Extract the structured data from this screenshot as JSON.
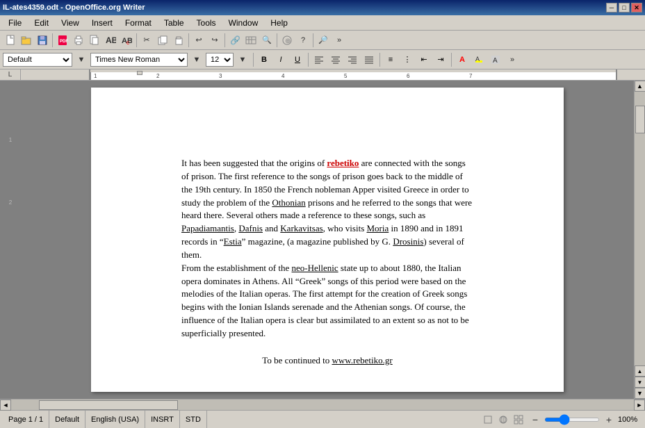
{
  "titleBar": {
    "title": "IL-ates4359.odt - OpenOffice.org Writer",
    "minimize": "─",
    "maximize": "□",
    "close": "✕"
  },
  "menuBar": {
    "items": [
      "File",
      "Edit",
      "View",
      "Insert",
      "Format",
      "Table",
      "Tools",
      "Window",
      "Help"
    ]
  },
  "toolbar1": {
    "new_icon": "📄",
    "open_icon": "📂",
    "save_icon": "💾"
  },
  "formatBar": {
    "style_value": "Default",
    "font_value": "Times New Roman",
    "size_value": "12",
    "bold": "B",
    "italic": "I",
    "underline": "U"
  },
  "documentContent": {
    "paragraph1": "It has been suggested that the origins of ",
    "rebetiko": "rebetiko",
    "paragraph1b": " are connected with the songs of prison. The first reference to the songs of prison goes back to the middle of the 19th century. In 1850 the French nobleman Apper visited Greece in order to study the problem of the ",
    "othonian": "Othonian",
    "paragraph1c": " prisons and he referred to the songs that were heard there. Several others made a reference to these songs, such as ",
    "papadiamantis": "Papadiamantis",
    "paragraph1d": ", ",
    "dafnis": "Dafnis",
    "paragraph1e": " and ",
    "karkavitsas": "Karkavitsas",
    "paragraph1f": ", who visits ",
    "moria": "Moria",
    "paragraph1g": " in 1890 and in 1891 records in “",
    "estia": "Estia",
    "paragraph1h": "” magazine, (a magazine published by G. ",
    "drosinis": "Drosinis",
    "paragraph1i": ") several of them.",
    "paragraph2": "From the establishment of the ",
    "neo_hellenic": "neo-Hellenic",
    "paragraph2b": " state up to about 1880, the Italian opera dominates in Athens. All “Greek” songs of this period were based on the melodies of the Italian operas. The first attempt for the creation of Greek songs begins with the Ionian Islands serenade and the Athenian songs. Of course, the influence of the Italian opera is clear but assimilated to an extent so as not to be superficially presented.",
    "continued": "To be continued to ",
    "url": "www.rebetiko.gr"
  },
  "statusBar": {
    "page": "Page 1 / 1",
    "style": "Default",
    "language": "English (USA)",
    "mode1": "INSRT",
    "mode2": "STD",
    "zoom": "100%"
  }
}
